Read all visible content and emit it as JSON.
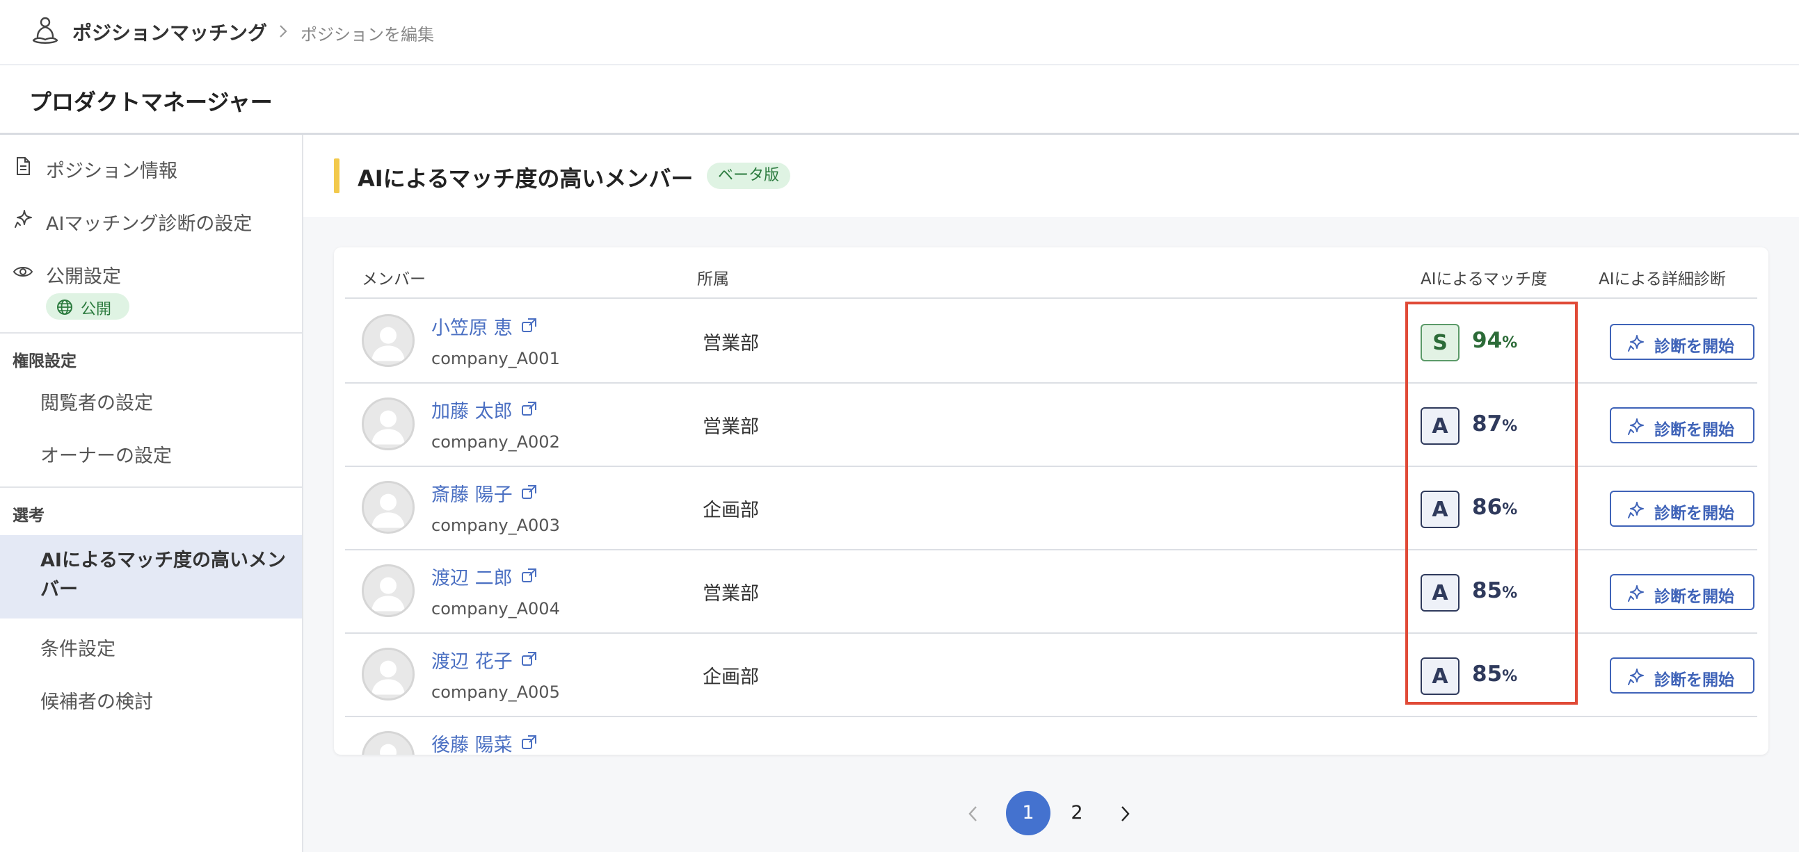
{
  "header": {
    "app_title": "ポジションマッチング",
    "breadcrumb": "ポジションを編集"
  },
  "page": {
    "title": "プロダクトマネージャー"
  },
  "sidebar": {
    "position_info": "ポジション情報",
    "ai_settings": "AIマッチング診断の設定",
    "publish_settings": "公開設定",
    "publish_badge": "公開",
    "permissions_section": "権限設定",
    "viewer_settings": "閲覧者の設定",
    "owner_settings": "オーナーの設定",
    "selection_section": "選考",
    "ai_match_members": "AIによるマッチ度の高いメンバー",
    "conditions": "条件設定",
    "candidates": "候補者の検討"
  },
  "section": {
    "title": "AIによるマッチ度の高いメンバー",
    "beta_badge": "ベータ版"
  },
  "table": {
    "headers": {
      "member": "メンバー",
      "department": "所属",
      "match": "AIによるマッチ度",
      "diagnosis": "AIによる詳細診断"
    },
    "rows": [
      {
        "name": "小笠原 恵",
        "code": "company_A001",
        "dept": "営業部",
        "grade": "S",
        "pct": "94",
        "button": "診断を開始"
      },
      {
        "name": "加藤 太郎",
        "code": "company_A002",
        "dept": "営業部",
        "grade": "A",
        "pct": "87",
        "button": "診断を開始"
      },
      {
        "name": "斎藤 陽子",
        "code": "company_A003",
        "dept": "企画部",
        "grade": "A",
        "pct": "86",
        "button": "診断を開始"
      },
      {
        "name": "渡辺 二郎",
        "code": "company_A004",
        "dept": "営業部",
        "grade": "A",
        "pct": "85",
        "button": "診断を開始"
      },
      {
        "name": "渡辺 花子",
        "code": "company_A005",
        "dept": "企画部",
        "grade": "A",
        "pct": "85",
        "button": "診断を開始"
      },
      {
        "name": "後藤 陽菜",
        "code": "",
        "dept": "",
        "grade": "",
        "pct": "",
        "button": ""
      }
    ],
    "percent_suffix": "%"
  },
  "pagination": {
    "pages": [
      "1",
      "2"
    ],
    "current": "1"
  },
  "colors": {
    "accent_blue": "#4472cf",
    "grade_s_green": "#2c6b38",
    "grade_a_navy": "#2f3a5c",
    "highlight_red": "#e04a37",
    "section_accent_yellow": "#f2c94c"
  },
  "icons": {
    "app": "meditation-person-icon",
    "position_info": "document-icon",
    "ai_settings": "sparkle-icon",
    "publish": "eye-icon",
    "publish_badge": "globe-icon",
    "external": "external-link-icon",
    "diagnose": "sparkle-icon"
  }
}
